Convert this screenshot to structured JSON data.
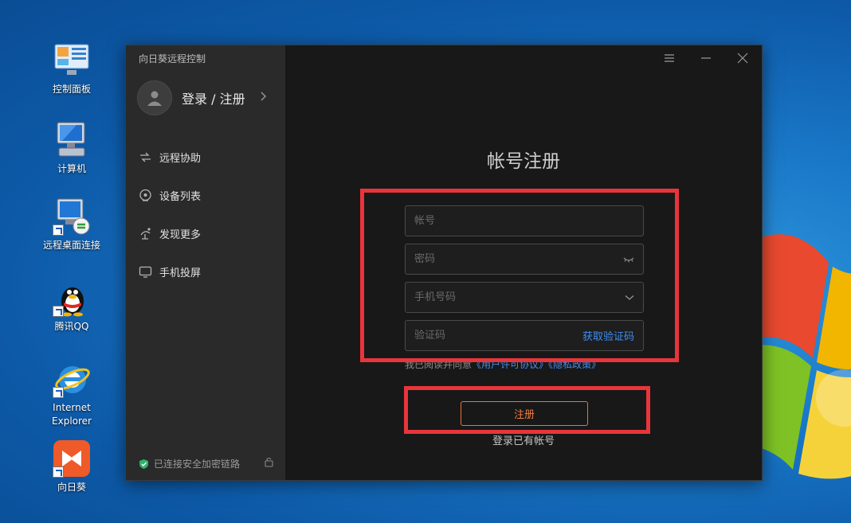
{
  "desktop": {
    "icons": [
      {
        "label": "控制面板",
        "icon": "control-panel-icon"
      },
      {
        "label": "计算机",
        "icon": "computer-icon"
      },
      {
        "label": "远程桌面连接",
        "icon": "remote-desktop-icon"
      },
      {
        "label": "腾讯QQ",
        "icon": "qq-icon"
      },
      {
        "label": "Internet Explorer",
        "icon": "internet-explorer-icon"
      },
      {
        "label": "向日葵",
        "icon": "sunlogin-icon"
      }
    ]
  },
  "app": {
    "title": "向日葵远程控制",
    "user": {
      "label": "登录 / 注册"
    },
    "nav": [
      {
        "label": "远程协助",
        "icon": "remote-assist-icon"
      },
      {
        "label": "设备列表",
        "icon": "device-list-icon"
      },
      {
        "label": "发现更多",
        "icon": "discover-icon"
      },
      {
        "label": "手机投屏",
        "icon": "phone-cast-icon"
      }
    ],
    "status": {
      "text": "已连接安全加密链路"
    },
    "window_controls": [
      "menu-icon",
      "minimize-icon",
      "close-icon"
    ]
  },
  "form": {
    "title": "帐号注册",
    "account_placeholder": "帐号",
    "password_placeholder": "密码",
    "phone_placeholder": "手机号码",
    "code_placeholder": "验证码",
    "get_code": "获取验证码",
    "agreement_prefix": "我已阅读并同意",
    "agreement_terms": "《用户许可协议》",
    "agreement_privacy": "《隐私政策》",
    "register_button": "注册",
    "login_link": "登录已有帐号"
  },
  "colors": {
    "accent_orange": "#e8743a",
    "link_blue": "#3f8ef0",
    "annotation_red": "#e8353b",
    "secure_green": "#2fb26a"
  }
}
